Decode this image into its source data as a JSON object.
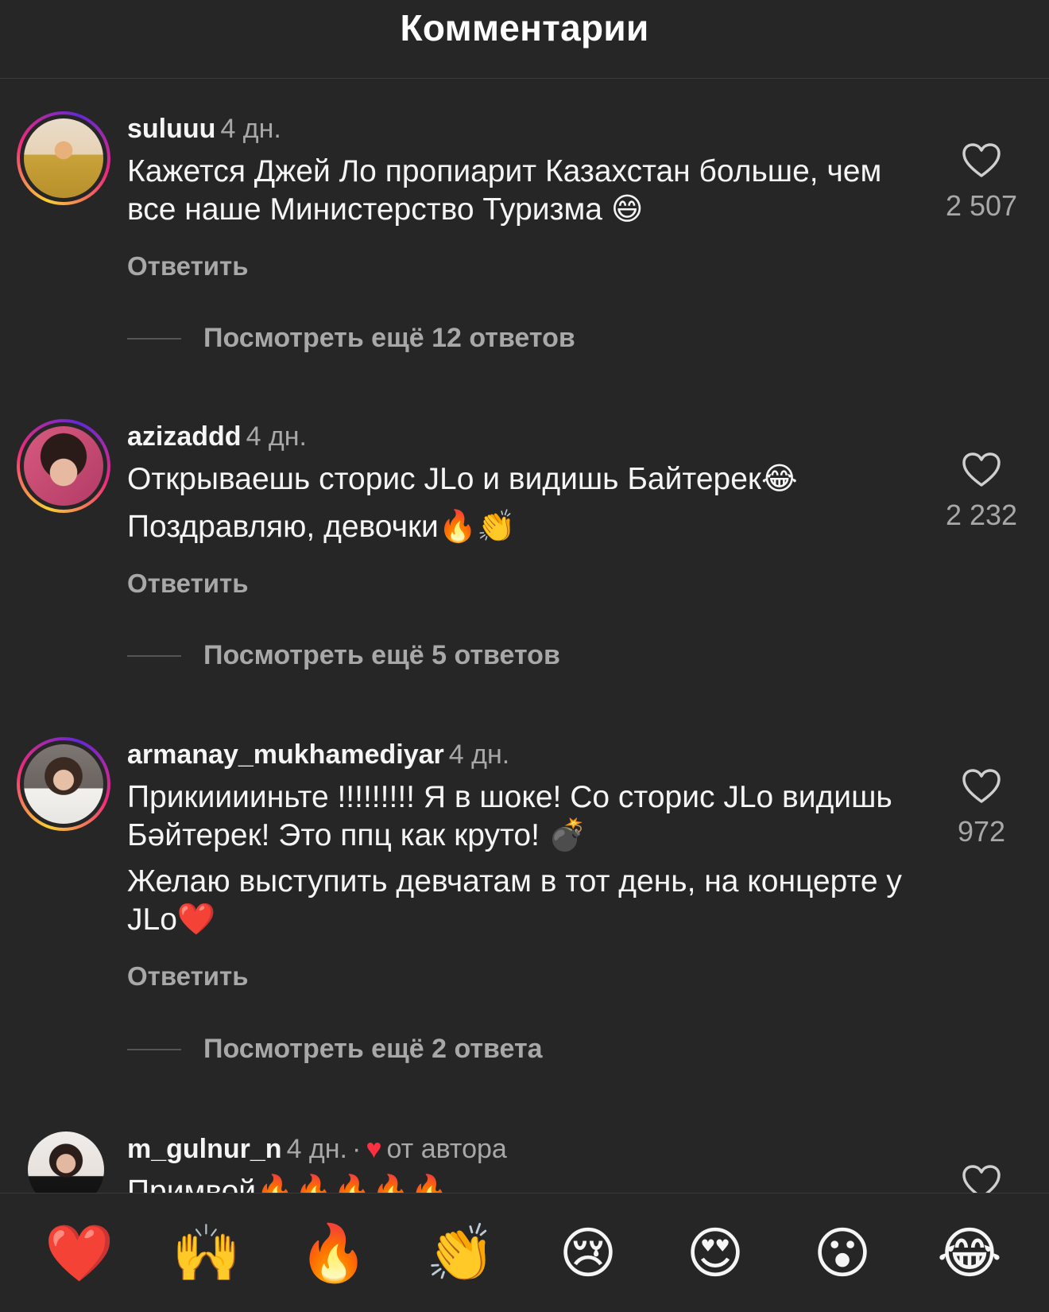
{
  "header": {
    "title": "Комментарии"
  },
  "comments": [
    {
      "username": "suluuu",
      "time": "4 дн.",
      "lines": [
        "Кажется Джей Ло пропиарит Казахстан больше, чем все наше Министерство Туризма 😄"
      ],
      "likes": "2 507",
      "reply_label": "Ответить",
      "more_replies": "Посмотреть ещё 12 ответов"
    },
    {
      "username": "azizaddd",
      "time": "4 дн.",
      "lines": [
        "Открываешь сторис JLo и видишь Байтерек😂",
        "Поздравляю, девочки🔥👏"
      ],
      "likes": "2 232",
      "reply_label": "Ответить",
      "more_replies": "Посмотреть ещё 5 ответов"
    },
    {
      "username": "armanay_mukhamediyar",
      "time": "4 дн.",
      "lines": [
        "Прикииииньте !!!!!!!!! Я в шоке! Со сторис JLo видишь Бәйтерек! Это ппц как круто! 💣",
        "Желаю выступить девчатам в тот день, на концерте у JLo❤️"
      ],
      "likes": "972",
      "reply_label": "Ответить",
      "more_replies": "Посмотреть ещё 2 ответа"
    },
    {
      "username": "m_gulnur_n",
      "time": "4 дн.",
      "separator": "·",
      "author_label": "от автора",
      "lines": [
        "Примвой🔥🔥🔥🔥🔥"
      ]
    }
  ],
  "emoji_bar": [
    "❤️",
    "🙌",
    "🔥",
    "👏",
    "😢",
    "😍",
    "😮",
    "😂"
  ],
  "colors": {
    "background": "#262626",
    "text": "#f5f5f5",
    "secondary": "#a8a8a8",
    "author_heart": "#ff3040"
  },
  "icons": {
    "like": "heart-outline-icon",
    "author_like": "heart-filled-icon"
  }
}
